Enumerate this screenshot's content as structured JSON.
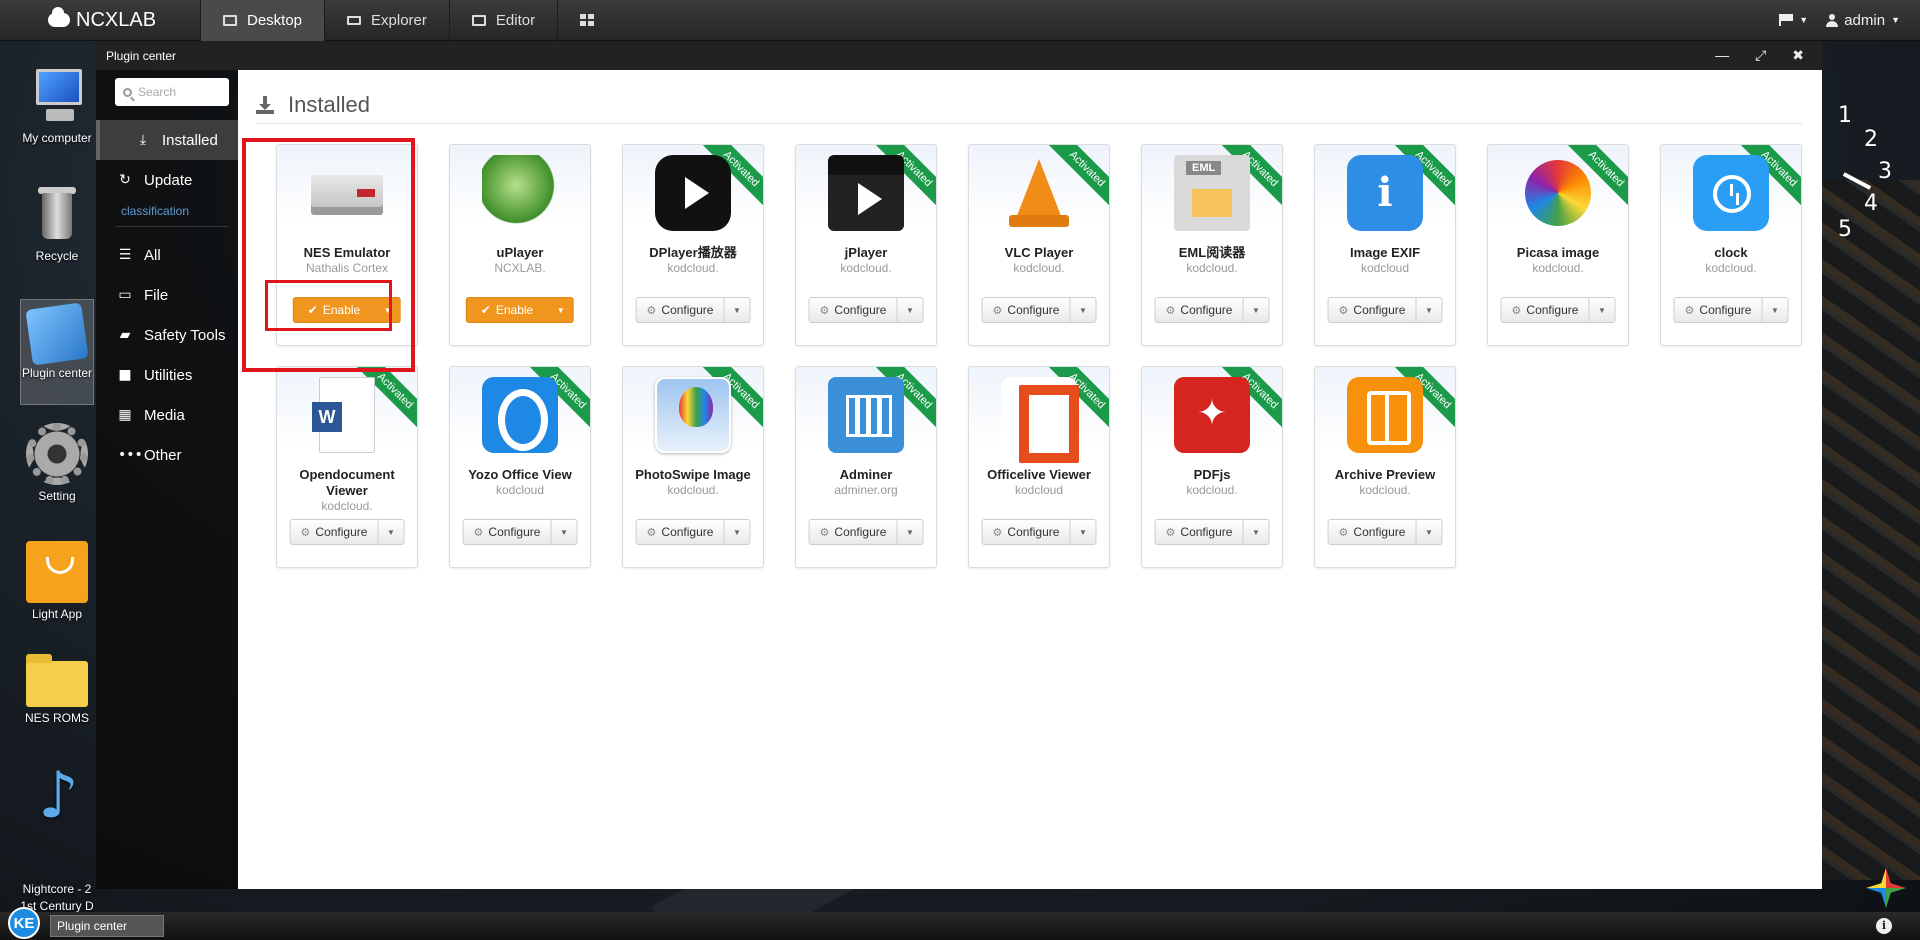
{
  "topbar": {
    "logo": "NCXLAB",
    "nav": [
      {
        "label": "Desktop",
        "active": true
      },
      {
        "label": "Explorer",
        "active": false
      },
      {
        "label": "Editor",
        "active": false
      }
    ],
    "user": "admin"
  },
  "desktop_icons": [
    {
      "label": "My computer"
    },
    {
      "label": "Recycle"
    },
    {
      "label": "Plugin center"
    },
    {
      "label": "Setting"
    },
    {
      "label": "Light App"
    },
    {
      "label": "NES ROMS"
    },
    {
      "label": "Nightcore - 2\n1st Century D"
    }
  ],
  "window": {
    "title": "Plugin center",
    "controls": [
      "minimize",
      "maximize",
      "close"
    ]
  },
  "sidebar": {
    "search_placeholder": "Search",
    "items": [
      {
        "label": "Installed",
        "icon": "download-icon",
        "active": true
      },
      {
        "label": "Update",
        "icon": "refresh-icon"
      }
    ],
    "classification_label": "classification",
    "categories": [
      {
        "label": "All",
        "icon": "list-icon"
      },
      {
        "label": "File",
        "icon": "folder-icon"
      },
      {
        "label": "Safety Tools",
        "icon": "book-icon"
      },
      {
        "label": "Utilities",
        "icon": "briefcase-icon"
      },
      {
        "label": "Media",
        "icon": "film-icon"
      },
      {
        "label": "Other",
        "icon": "ellipsis-icon"
      }
    ]
  },
  "main": {
    "heading": "Installed",
    "ribbon_text": "Activated",
    "plugins": [
      {
        "name": "NES Emulator",
        "author": "Nathalis Cortex",
        "button": "Enable",
        "activated": false,
        "icon": "nes-icon"
      },
      {
        "name": "uPlayer",
        "author": "NCXLAB.",
        "button": "Enable",
        "activated": false,
        "icon": "uplayer-icon"
      },
      {
        "name": "DPlayer播放器",
        "author": "kodcloud.",
        "button": "Configure",
        "activated": true,
        "icon": "dplayer-icon"
      },
      {
        "name": "jPlayer",
        "author": "kodcloud.",
        "button": "Configure",
        "activated": true,
        "icon": "jplayer-icon"
      },
      {
        "name": "VLC Player",
        "author": "kodcloud.",
        "button": "Configure",
        "activated": true,
        "icon": "vlc-icon"
      },
      {
        "name": "EML阅读器",
        "author": "kodcloud.",
        "button": "Configure",
        "activated": true,
        "icon": "eml-icon"
      },
      {
        "name": "Image EXIF",
        "author": "kodcloud",
        "button": "Configure",
        "activated": true,
        "icon": "exif-icon"
      },
      {
        "name": "Picasa image",
        "author": "kodcloud.",
        "button": "Configure",
        "activated": true,
        "icon": "picasa-icon"
      },
      {
        "name": "clock",
        "author": "kodcloud.",
        "button": "Configure",
        "activated": true,
        "icon": "clock-icon"
      },
      {
        "name": "Opendocument Viewer",
        "author": "kodcloud.",
        "button": "Configure",
        "activated": true,
        "icon": "word-doc-icon"
      },
      {
        "name": "Yozo Office View",
        "author": "kodcloud",
        "button": "Configure",
        "activated": true,
        "icon": "yozo-icon"
      },
      {
        "name": "PhotoSwipe Image",
        "author": "kodcloud.",
        "button": "Configure",
        "activated": true,
        "icon": "photo-icon"
      },
      {
        "name": "Adminer",
        "author": "adminer.org",
        "button": "Configure",
        "activated": true,
        "icon": "adminer-icon"
      },
      {
        "name": "Officelive Viewer",
        "author": "kodcloud",
        "button": "Configure",
        "activated": true,
        "icon": "office-icon"
      },
      {
        "name": "PDFjs",
        "author": "kodcloud.",
        "button": "Configure",
        "activated": true,
        "icon": "pdf-icon"
      },
      {
        "name": "Archive Preview",
        "author": "kodcloud.",
        "button": "Configure",
        "activated": true,
        "icon": "archive-icon"
      }
    ],
    "eml_tag": "EML",
    "exif_glyph": "i",
    "word_glyph": "W"
  },
  "clock_widget": [
    "1",
    "2",
    "3",
    "4",
    "5"
  ],
  "taskbar": {
    "start_label": "KE",
    "items": [
      "Plugin center"
    ],
    "info_glyph": "i"
  },
  "colors": {
    "accent_orange": "#f0961e",
    "activated_green": "#1b9a4a",
    "highlight_red": "#e0161e"
  }
}
